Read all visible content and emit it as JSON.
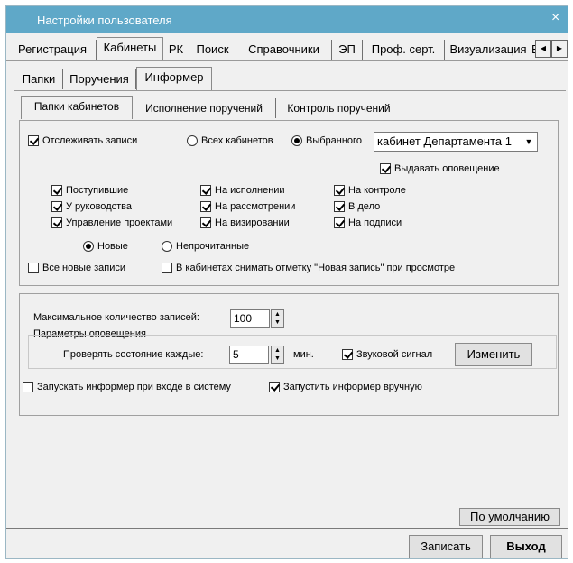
{
  "window": {
    "title": "Настройки пользователя",
    "close": "×"
  },
  "main_tabs": [
    "Регистрация",
    "Кабинеты",
    "РК",
    "Поиск",
    "Справочники",
    "ЭП",
    "Проф. серт.",
    "Визуализация"
  ],
  "main_tabs_overflow": "Ви",
  "sub_tabs": [
    "Папки",
    "Поручения",
    "Информер"
  ],
  "inner_tabs": [
    "Папки кабинетов",
    "Исполнение поручений",
    "Контроль поручений"
  ],
  "track": {
    "label": "Отслеживать записи",
    "all_label": "Всех кабинетов",
    "selected_label": "Выбранного",
    "cabinet_value": "кабинет Департамента 1",
    "notify_label": "Выдавать оповещение"
  },
  "folders": {
    "col1": [
      "Поступившие",
      "У руководства",
      "Управление проектами"
    ],
    "col2": [
      "На исполнении",
      "На рассмотрении",
      "На визировании"
    ],
    "col3": [
      "На контроле",
      "В дело",
      "На подписи"
    ]
  },
  "records": {
    "new_label": "Новые",
    "unread_label": "Непрочитанные",
    "all_new_label": "Все новые записи",
    "clear_mark_label": "В кабинетах снимать отметку \"Новая запись\" при просмотре"
  },
  "settings": {
    "max_label": "Максимальное количество записей:",
    "max_value": "100",
    "group_label": "Параметры оповещения",
    "check_label": "Проверять состояние каждые:",
    "check_value": "5",
    "unit": "мин.",
    "sound_label": "Звуковой сигнал",
    "change_button": "Изменить",
    "autostart_label": "Запускать информер при входе в систему",
    "manual_label": "Запустить информер вручную"
  },
  "footer": {
    "default_button": "По умолчанию",
    "save_button": "Записать",
    "exit_button": "Выход"
  }
}
